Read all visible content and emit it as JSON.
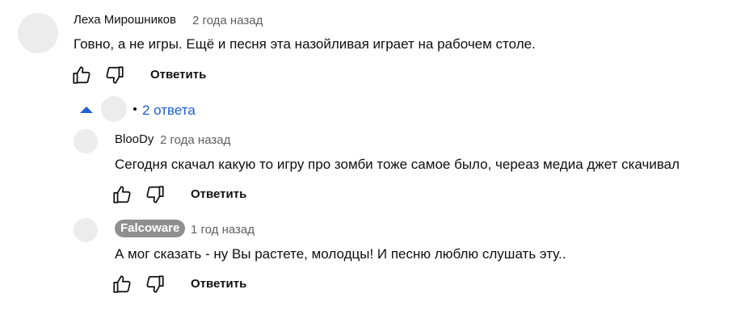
{
  "comments": [
    {
      "author": "Леха Мирошников",
      "time": "2 года назад",
      "text": "Говно, а не игры. Ещё и песня эта назойливая играет на рабочем столе.",
      "reply_label": "Ответить"
    }
  ],
  "replies_toggle": {
    "label": "2 ответа",
    "accent_color": "#1f5fd1"
  },
  "replies": [
    {
      "author": "BlooDy",
      "time": "2 года назад",
      "text": "Сегодня скачал какую то игру про зомби тоже самое было, череаз медиа джет скачивал",
      "reply_label": "Ответить"
    },
    {
      "author": "Falcoware",
      "author_is_channel_owner": true,
      "time": "1 год назад",
      "text": "А мог сказать - ну Вы растете, молодцы! И песню люблю слушать эту..",
      "reply_label": "Ответить"
    }
  ],
  "icons": {
    "like": "thumbs-up-icon",
    "dislike": "thumbs-down-icon"
  }
}
